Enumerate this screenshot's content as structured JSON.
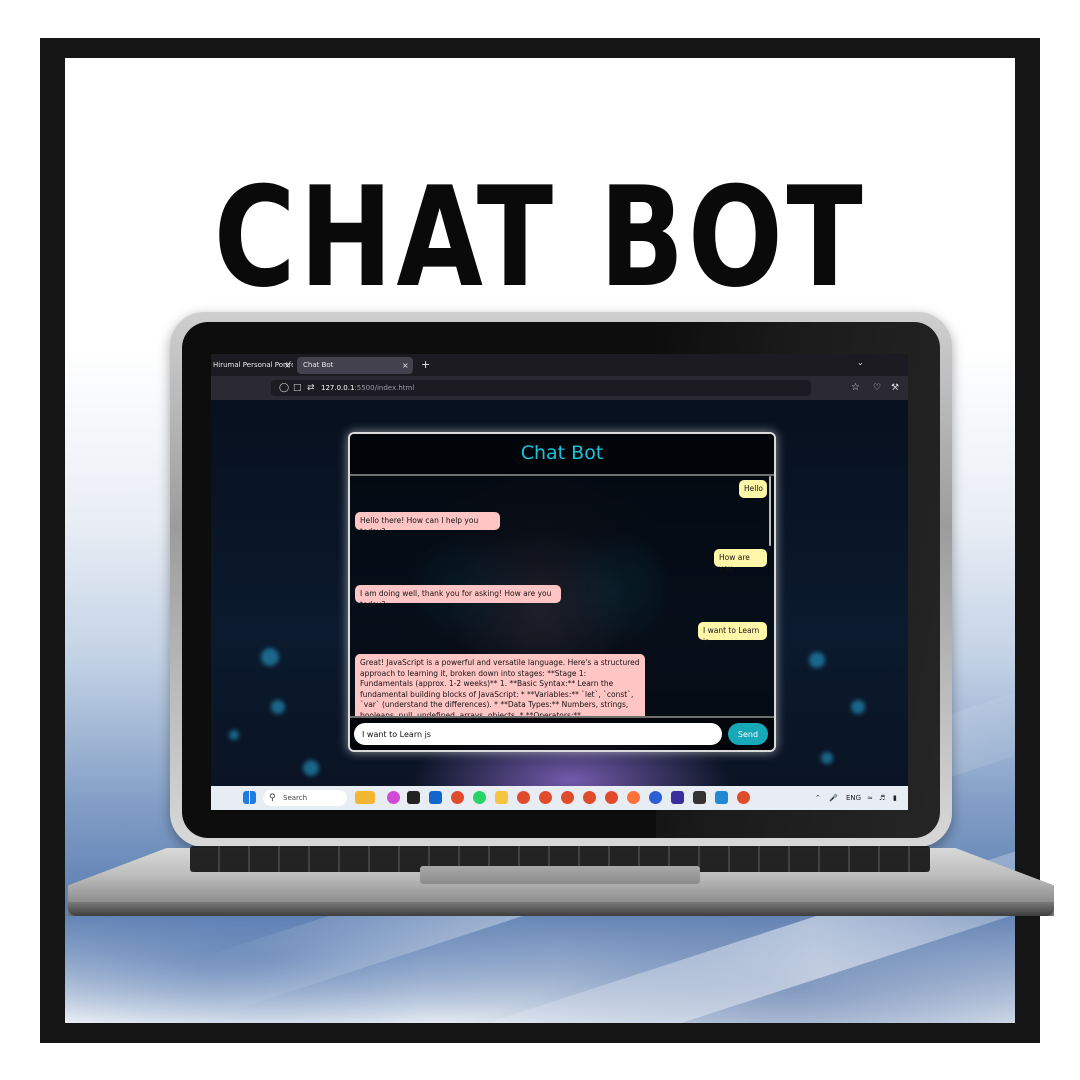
{
  "poster": {
    "title": "CHAT BOT"
  },
  "browser": {
    "tabs": [
      {
        "label": "Hirumal Personal Portfol"
      },
      {
        "label": "Chat Bot"
      }
    ],
    "new_tab": "+",
    "close_glyph": "×",
    "url_host": "127.0.0.1",
    "url_path": ":5500/index.html"
  },
  "chat": {
    "title": "Chat Bot",
    "messages": [
      {
        "sender": "user",
        "text": "Hello"
      },
      {
        "sender": "bot",
        "text": "Hello there! How can I help you today?"
      },
      {
        "sender": "user",
        "text": "How are you"
      },
      {
        "sender": "bot",
        "text": "I am doing well, thank you for asking! How are you today?"
      },
      {
        "sender": "user",
        "text": "I want to Learn js"
      },
      {
        "sender": "bot",
        "text": "Great! JavaScript is a powerful and versatile language. Here's a structured approach to learning it, broken down into stages: **Stage 1: Fundamentals (approx. 1-2 weeks)** 1. **Basic Syntax:** Learn the fundamental building blocks of JavaScript: * **Variables:** `let`, `const`, `var` (understand the differences). * **Data Types:** Numbers, strings, booleans, null, undefined, arrays, objects. * **Operators:**"
      }
    ],
    "input_value": "I want to Learn js",
    "send_label": "Send"
  },
  "taskbar": {
    "search_label": "Search",
    "language": "ENG"
  },
  "colors": {
    "accent": "#19c3d9",
    "send_button": "#17a9b8",
    "user_bubble": "#fff6a8",
    "bot_bubble": "#ffc4c4"
  }
}
